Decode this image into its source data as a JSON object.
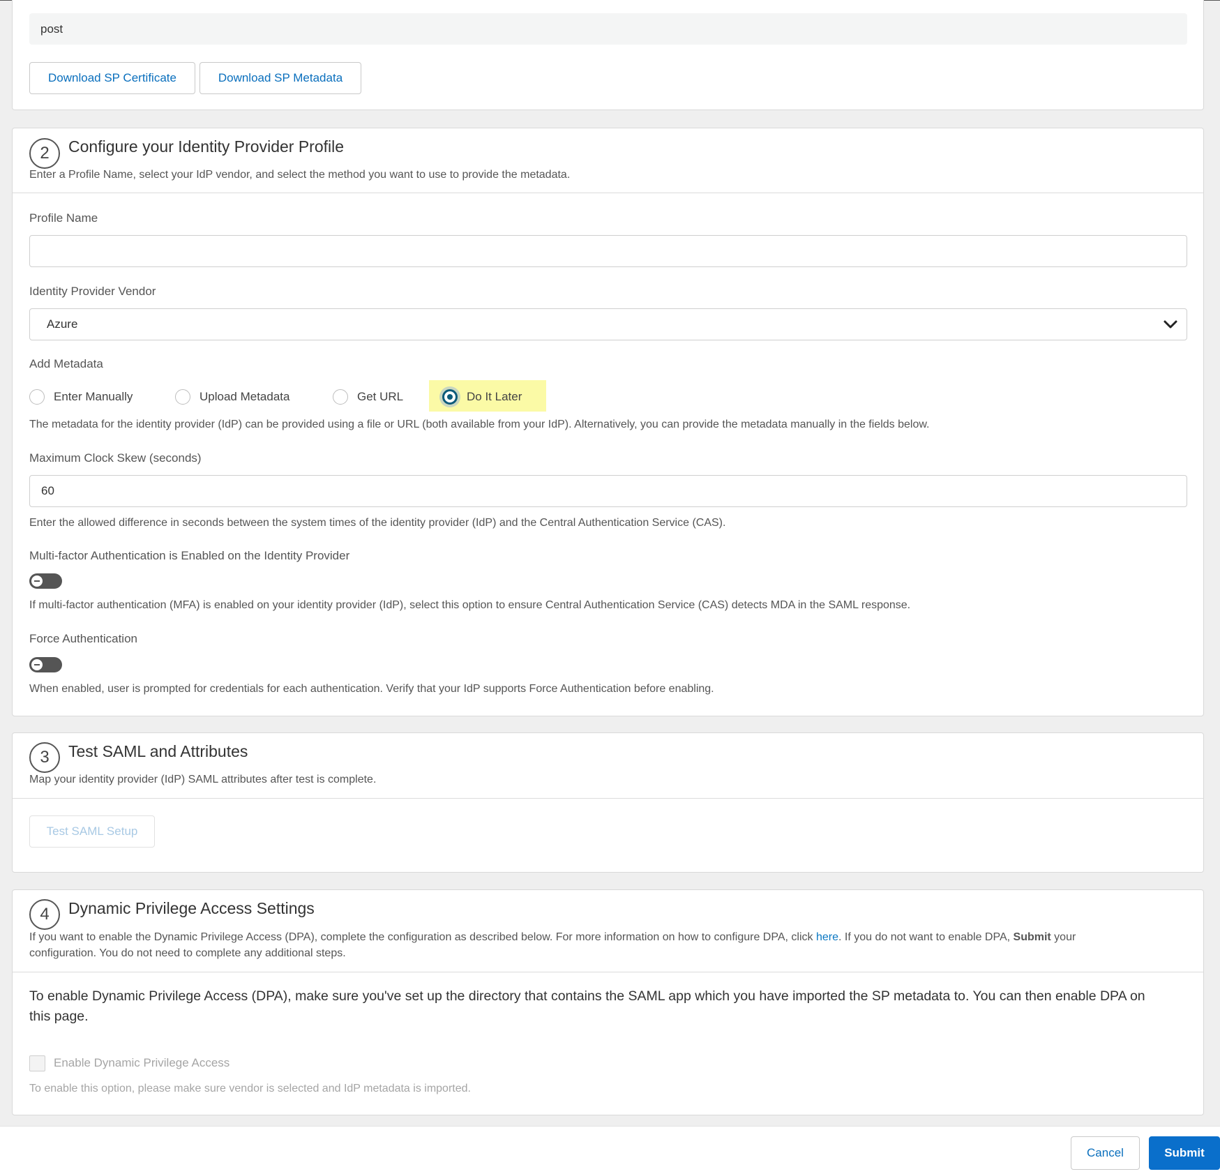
{
  "step1": {
    "binding_value": "post",
    "download_cert_label": "Download SP Certificate",
    "download_metadata_label": "Download SP Metadata"
  },
  "step2": {
    "number": "2",
    "title": "Configure your Identity Provider Profile",
    "description": "Enter a Profile Name, select your IdP vendor, and select the method you want to use to provide the metadata.",
    "profile_name_label": "Profile Name",
    "profile_name_value": "",
    "vendor_label": "Identity Provider Vendor",
    "vendor_value": "Azure",
    "add_metadata_label": "Add Metadata",
    "metadata_options": [
      "Enter Manually",
      "Upload Metadata",
      "Get URL",
      "Do It Later"
    ],
    "metadata_selected": "Do It Later",
    "metadata_help": "The metadata for the identity provider (IdP) can be provided using a file or URL (both available from your IdP). Alternatively, you can provide the metadata manually in the fields below.",
    "clock_skew_label": "Maximum Clock Skew (seconds)",
    "clock_skew_value": "60",
    "clock_skew_help": "Enter the allowed difference in seconds between the system times of the identity provider (IdP) and the Central Authentication Service (CAS).",
    "mfa_label": "Multi-factor Authentication is Enabled on the Identity Provider",
    "mfa_help": "If multi-factor authentication (MFA) is enabled on your identity provider (IdP), select this option to ensure Central Authentication Service (CAS) detects MDA in the SAML response.",
    "force_auth_label": "Force Authentication",
    "force_auth_help": "When enabled, user is prompted for credentials for each authentication. Verify that your IdP supports Force Authentication before enabling."
  },
  "step3": {
    "number": "3",
    "title": "Test SAML and Attributes",
    "description": "Map your identity provider (IdP) SAML attributes after test is complete.",
    "test_button_label": "Test SAML Setup"
  },
  "step4": {
    "number": "4",
    "title": "Dynamic Privilege Access Settings",
    "desc_part1": "If you want to enable the Dynamic Privilege Access (DPA), complete the configuration as described below. For more information on how to configure DPA, click ",
    "desc_link": "here",
    "desc_part2": ". If you do not want to enable DPA, ",
    "desc_bold": "Submit",
    "desc_part3": " your",
    "desc_line2": "configuration. You do not need to complete any additional steps.",
    "info_line1": "To enable Dynamic Privilege Access (DPA), make sure you've set up the directory that contains the SAML app which you have imported the SP metadata to. You can then enable DPA on",
    "info_line2": "this page.",
    "checkbox_label": "Enable Dynamic Privilege Access",
    "checkbox_help": "To enable this option, please make sure vendor is selected and IdP metadata is imported."
  },
  "footer": {
    "cancel_label": "Cancel",
    "submit_label": "Submit"
  }
}
